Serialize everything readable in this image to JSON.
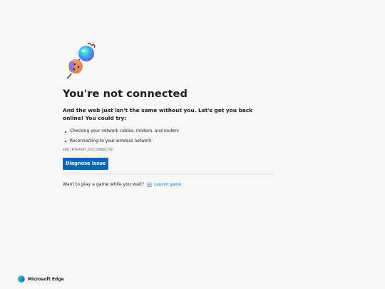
{
  "error_page": {
    "title": "You're not connected",
    "subtitle": "And the web just isn't the same without you. Let's get you back online! You could try:",
    "suggestions": [
      "Checking your network cables, modem, and routers",
      "Reconnecting to your wireless network"
    ],
    "error_code": "ERR_INTERNET_DISCONNECTED",
    "diagnose_label": "Diagnose Issue",
    "game_prompt": "Want to play a game while you wait?",
    "launch_game_label": "Launch game",
    "icons": {
      "illustration": "unplugged-plug-icon",
      "launch": "game-list-icon",
      "brand": "edge-logo-icon"
    }
  },
  "footer": {
    "brand_label": "Microsoft Edge"
  },
  "colors": {
    "background": "#f7f7f7",
    "accent": "#0067b8",
    "text": "#1b1b1b"
  }
}
